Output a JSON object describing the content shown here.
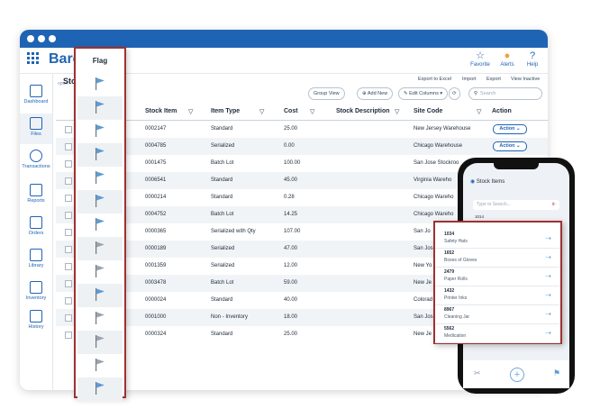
{
  "app": {
    "title": "Barc   ock",
    "header_buttons": [
      {
        "label": "Favorite",
        "icon": "star-icon"
      },
      {
        "label": "Alerts",
        "icon": "bell-icon"
      },
      {
        "label": "Help",
        "icon": "question-icon"
      }
    ]
  },
  "sidebar": {
    "items": [
      {
        "label": "Dashboard",
        "icon": "house-icon"
      },
      {
        "label": "Files",
        "icon": "folder-icon"
      },
      {
        "label": "Transactions",
        "icon": "check-circle-icon"
      },
      {
        "label": "Reports",
        "icon": "chart-icon"
      },
      {
        "label": "Orders",
        "icon": "document-icon"
      },
      {
        "label": "Library",
        "icon": "image-icon"
      },
      {
        "label": "Inventory",
        "icon": "box-icon"
      },
      {
        "label": "History",
        "icon": "list-icon"
      }
    ]
  },
  "page": {
    "breadcrumb": "open i",
    "title": "Sto",
    "top_links": [
      "Export to Excel",
      "Import",
      "Export",
      "View Inactive"
    ],
    "toolbar": {
      "group_view": "Group View",
      "add_new": "Add New",
      "edit_columns": "Edit Columns",
      "search_placeholder": "Search"
    }
  },
  "table": {
    "columns": [
      "Stock Item",
      "Item Type",
      "Cost",
      "Stock Description",
      "Site Code",
      "Action"
    ],
    "action_label": "Action",
    "rows": [
      {
        "item": "0002147",
        "type": "Standard",
        "cost": "25.00",
        "site": "New Jersey Warehouse",
        "action": true
      },
      {
        "item": "0004785",
        "type": "Serialized",
        "cost": "0.00",
        "site": "Chicago Warehouse",
        "action": true
      },
      {
        "item": "0001475",
        "type": "Batch Lot",
        "cost": "100.00",
        "site": "San Jose Stockroo",
        "action": false
      },
      {
        "item": "0006541",
        "type": "Standard",
        "cost": "45.00",
        "site": "Virginia Wareho",
        "action": false
      },
      {
        "item": "0000214",
        "type": "Standard",
        "cost": "0.28",
        "site": "Chicago Wareho",
        "action": false
      },
      {
        "item": "0004752",
        "type": "Batch Lot",
        "cost": "14.25",
        "site": "Chicago Wareho",
        "action": false
      },
      {
        "item": "0000365",
        "type": "Serialized with Qty",
        "cost": "107.00",
        "site": "San Jo",
        "action": false
      },
      {
        "item": "0000189",
        "type": "Serialized",
        "cost": "47.00",
        "site": "San Jos",
        "action": false
      },
      {
        "item": "0001359",
        "type": "Serialized",
        "cost": "12.00",
        "site": "New Yo",
        "action": false
      },
      {
        "item": "0003478",
        "type": "Batch Lot",
        "cost": "59.00",
        "site": "New Je",
        "action": false
      },
      {
        "item": "0000024",
        "type": "Standard",
        "cost": "40.00",
        "site": "Colorad",
        "action": false
      },
      {
        "item": "0001000",
        "type": "Non - Inventory",
        "cost": "18.00",
        "site": "San Jos",
        "action": false
      },
      {
        "item": "0000324",
        "type": "Standard",
        "cost": "25.00",
        "site": "New Je",
        "action": false
      }
    ]
  },
  "flag_panel": {
    "title": "Flag",
    "flags": [
      "blue",
      "blue",
      "blue",
      "blue",
      "blue",
      "blue",
      "blue",
      "gray",
      "gray",
      "blue",
      "gray",
      "gray",
      "gray",
      "blue"
    ]
  },
  "colors": {
    "brand": "#1f64b4",
    "flag_blue": "#5b9bd5",
    "flag_gray": "#9aa3ad",
    "highlight_border": "#a03030"
  },
  "phone": {
    "title": "Stock Items",
    "search_placeholder": "Type to Search...",
    "peek_label": "1014",
    "items": [
      {
        "num": "1034",
        "name": "Safety Hats"
      },
      {
        "num": "1652",
        "name": "Boxes of Gloves"
      },
      {
        "num": "2479",
        "name": "Paper Rolls"
      },
      {
        "num": "1432",
        "name": "Printer Inks"
      },
      {
        "num": "8967",
        "name": "Cleaning Jar"
      },
      {
        "num": "5562",
        "name": "Medication"
      }
    ]
  }
}
